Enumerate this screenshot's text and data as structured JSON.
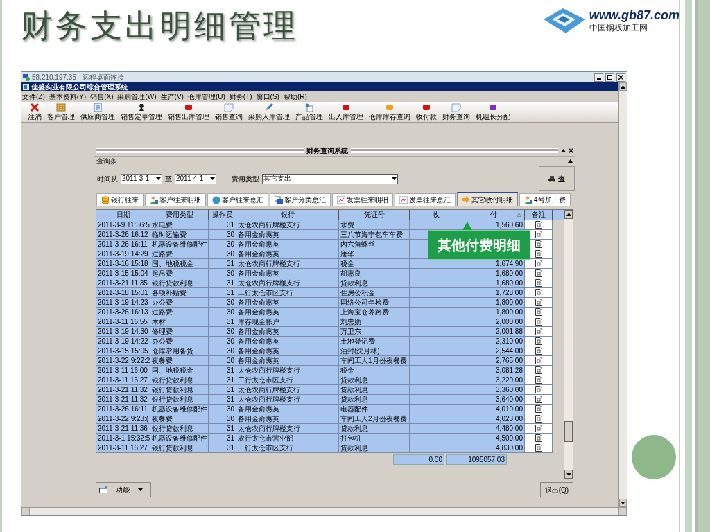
{
  "slide": {
    "title": "财务支出明细管理",
    "logo": {
      "url": "www.gb87.com",
      "subtitle": "中国钢板加工网"
    }
  },
  "remote_window": {
    "title": "58.210.197.35 - 远程桌面连接"
  },
  "app": {
    "title": "佳盛实业有限公司综合管理系统",
    "menu": [
      "文件(Z)",
      "基本资料(Y)",
      "销售(X)",
      "采购管理(W)",
      "生产(V)",
      "仓库管理(U)",
      "财务(T)",
      "窗口(S)",
      "帮助(R)"
    ],
    "toolbar": [
      {
        "label": "注消",
        "kind": "close"
      },
      {
        "label": "客户管理",
        "kind": "grid"
      },
      {
        "label": "供应商管理",
        "kind": "doc"
      },
      {
        "label": "销售定单管理",
        "kind": "chess"
      },
      {
        "label": "销售出库管理",
        "kind": "gem",
        "color": "#d81010"
      },
      {
        "label": "销售查询",
        "kind": "note"
      },
      {
        "label": "采购入库管理",
        "kind": "pen"
      },
      {
        "label": "产品管理",
        "kind": "box"
      },
      {
        "label": "出入库管理",
        "kind": "gem",
        "color": "#d81010"
      },
      {
        "label": "仓库库存查询",
        "kind": "gem",
        "color": "#f0a020"
      },
      {
        "label": "收付款",
        "kind": "gem",
        "color": "#d81010"
      },
      {
        "label": "财务查询",
        "kind": "note"
      },
      {
        "label": "机组长分配",
        "kind": "gem",
        "color": "#7a30c0"
      }
    ]
  },
  "child": {
    "title": "财务查询系统",
    "section": "查询条",
    "filters": {
      "from_label": "时间从",
      "from": "2011-3-1",
      "to_label": "至",
      "to": "2011-4-1",
      "type_label": "费用类型",
      "type": "其它支出"
    },
    "search_button": "查",
    "tabs": [
      {
        "label": "银行往来",
        "kind": "coins",
        "selected": false
      },
      {
        "label": "客户往来明细",
        "kind": "person",
        "selected": false
      },
      {
        "label": "客户往来总汇",
        "kind": "globe",
        "selected": false
      },
      {
        "label": "客户分类总汇",
        "kind": "windows",
        "selected": false
      },
      {
        "label": "发票往来明细",
        "kind": "chart",
        "selected": false
      },
      {
        "label": "发票往来总汇",
        "kind": "chart",
        "selected": false
      },
      {
        "label": "其它收付明细",
        "kind": "arrow",
        "selected": true
      },
      {
        "label": "4号加工费",
        "kind": "person",
        "selected": false
      }
    ],
    "table": {
      "columns": [
        "日期",
        "费用类型",
        "操作员",
        "银行",
        "凭证号",
        "收",
        "付",
        "备注"
      ],
      "rows": [
        {
          "date": "2011-3-9 11:36:5",
          "type": "水电费",
          "operator": "31",
          "bank": "太仓农商行牌楼支行",
          "voucher": "水费",
          "pay": "1,560.60"
        },
        {
          "date": "2011-3-26 16:12",
          "type": "临时运输费",
          "operator": "30",
          "bank": "备用金俞惠英",
          "voucher": "三八节海宁包车车费"
        },
        {
          "date": "2011-3-26 16:11",
          "type": "机器设备维修配件",
          "operator": "30",
          "bank": "备用金俞惠英",
          "voucher": "内六角螺丝"
        },
        {
          "date": "2011-3-19 14:29",
          "type": "过路费",
          "operator": "30",
          "bank": "备用金俞惠英",
          "voucher": "唐华"
        },
        {
          "date": "2011-3-16 15:18",
          "type": "国、地税税金",
          "operator": "31",
          "bank": "太仓农商行牌楼支行",
          "voucher": "税金",
          "pay": "1,674.90"
        },
        {
          "date": "2011-3-15 15:04",
          "type": "起吊费",
          "operator": "30",
          "bank": "备用金俞惠英",
          "voucher": "胡惠良",
          "pay": "1,680.00"
        },
        {
          "date": "2011-3-21 11:35",
          "type": "银行贷款利息",
          "operator": "31",
          "bank": "太仓农商行牌楼支行",
          "voucher": "贷款利息",
          "pay": "1,680.00"
        },
        {
          "date": "2011-3-18 15:01",
          "type": "各项补贴费",
          "operator": "31",
          "bank": "工行太仓市区支行",
          "voucher": "住房公积金",
          "pay": "1,728.00"
        },
        {
          "date": "2011-3-19 14:23",
          "type": "办公费",
          "operator": "30",
          "bank": "备用金俞惠英",
          "voucher": "网络公司年检费",
          "pay": "1,800.00"
        },
        {
          "date": "2011-3-26 16:13",
          "type": "过路费",
          "operator": "30",
          "bank": "备用金俞惠英",
          "voucher": "上海宝仓养路费",
          "pay": "1,800.00"
        },
        {
          "date": "2011-3-11 16:55",
          "type": "木材",
          "operator": "31",
          "bank": "库存现金帐户",
          "voucher": "刘忠勋",
          "pay": "2,000.00"
        },
        {
          "date": "2011-3-19 14:30",
          "type": "修理费",
          "operator": "30",
          "bank": "备用金俞惠英",
          "voucher": "万卫东",
          "pay": "2,001.88"
        },
        {
          "date": "2011-3-19 14:22",
          "type": "办公费",
          "operator": "30",
          "bank": "备用金俞惠英",
          "voucher": "土地登记费",
          "pay": "2,310.00"
        },
        {
          "date": "2011-3-15 15:05",
          "type": "仓库常用备货",
          "operator": "30",
          "bank": "备用金俞惠英",
          "voucher": "油封(沈月林)",
          "pay": "2,544.00"
        },
        {
          "date": "2011-3-22 9:22:2",
          "type": "夜餐费",
          "operator": "30",
          "bank": "备用金俞惠英",
          "voucher": "车间工人1月份夜餐费",
          "pay": "2,765.00"
        },
        {
          "date": "2011-3-11 16:00",
          "type": "国、地税税金",
          "operator": "31",
          "bank": "太仓农商行牌楼支行",
          "voucher": "税金",
          "pay": "3,081.28"
        },
        {
          "date": "2011-3-11 16:27",
          "type": "银行贷款利息",
          "operator": "31",
          "bank": "工行太仓市区支行",
          "voucher": "贷款利息",
          "pay": "3,220.00"
        },
        {
          "date": "2011-3-21 11:32",
          "type": "银行贷款利息",
          "operator": "31",
          "bank": "太仓农商行牌楼支行",
          "voucher": "贷款利息",
          "pay": "3,360.00"
        },
        {
          "date": "2011-3-21 11:32",
          "type": "银行贷款利息",
          "operator": "31",
          "bank": "太仓农商行牌楼支行",
          "voucher": "贷款利息",
          "pay": "3,640.00"
        },
        {
          "date": "2011-3-26 16:11",
          "type": "机器设备维修配件",
          "operator": "30",
          "bank": "备用金俞惠英",
          "voucher": "电器配件",
          "pay": "4,010.00"
        },
        {
          "date": "2011-3-22 9:23:(",
          "type": "夜餐费",
          "operator": "30",
          "bank": "备用金俞惠英",
          "voucher": "车间工人2月份夜餐费",
          "pay": "4,023.00"
        },
        {
          "date": "2011-3-21 11:36",
          "type": "银行贷款利息",
          "operator": "31",
          "bank": "太仓农商行牌楼支行",
          "voucher": "贷款利息",
          "pay": "4,480.00"
        },
        {
          "date": "2011-3-1 15:32:5",
          "type": "机器设备维修配件",
          "operator": "31",
          "bank": "农行太仓市营业部",
          "voucher": "打包机",
          "pay": "4,500.00"
        },
        {
          "date": "2011-3-11 16:27",
          "type": "银行贷款利息",
          "operator": "31",
          "bank": "工行太仓市区支行",
          "voucher": "贷款利息",
          "pay": "4,830.00"
        }
      ],
      "totals": {
        "receive": "0.00",
        "pay": "1095057.03"
      }
    },
    "function_button": "功能",
    "exit_button": "退出(Q)"
  },
  "callout": "其他付费明细"
}
